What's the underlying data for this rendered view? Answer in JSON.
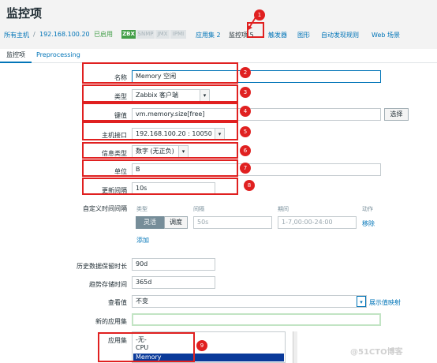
{
  "page": {
    "title": "监控项"
  },
  "breadcrumb": {
    "all_hosts": "所有主机",
    "separator": "/",
    "host": "192.168.100.20",
    "enabled": "已启用",
    "zbx": "ZBX",
    "snmp": "SNMP",
    "jmx": "JMX",
    "ipmi": "IPMI",
    "applications": "应用集 2",
    "items": "监控项 5",
    "triggers": "触发器",
    "graphs": "图形",
    "discovery": "自动发现规则",
    "web": "Web 场景"
  },
  "tabs": {
    "item": "监控项",
    "preprocessing": "Preprocessing"
  },
  "form": {
    "name_label": "名称",
    "name_value": "Memory 空闲",
    "type_label": "类型",
    "type_value": "Zabbix 客户端",
    "key_label": "键值",
    "key_value": "vm.memory.size[free]",
    "select_button": "选择",
    "interface_label": "主机接口",
    "interface_value": "192.168.100.20 : 10050",
    "info_type_label": "信息类型",
    "info_type_value": "数字 (无正负)",
    "units_label": "单位",
    "units_value": "B",
    "interval_label": "更新间隔",
    "interval_value": "10s",
    "custom_label": "自定义时间间隔",
    "custom_col_type": "类型",
    "custom_col_interval": "间隔",
    "custom_col_period": "期间",
    "custom_col_action": "动作",
    "flexible": "灵活",
    "scheduling": "调度",
    "custom_interval_placeholder": "50s",
    "custom_period_placeholder": "1-7,00:00-24:00",
    "remove": "移除",
    "add": "添加",
    "history_label": "历史数据保留时长",
    "history_value": "90d",
    "trends_label": "趋势存储时间",
    "trends_value": "365d",
    "valuemap_label": "查看值",
    "valuemap_value": "不变",
    "valuemap_link": "展示值映射",
    "new_app_label": "新的应用集",
    "new_app_value": "",
    "apps_label": "应用集",
    "apps_options": [
      "-无-",
      "CPU",
      "Memory"
    ]
  },
  "annotations": [
    "1",
    "2",
    "3",
    "4",
    "5",
    "6",
    "7",
    "8",
    "9"
  ],
  "watermark": "@51CTO博客",
  "colors": {
    "accent": "#0275b8",
    "highlight": "#e02020",
    "enabled": "#429e47"
  }
}
